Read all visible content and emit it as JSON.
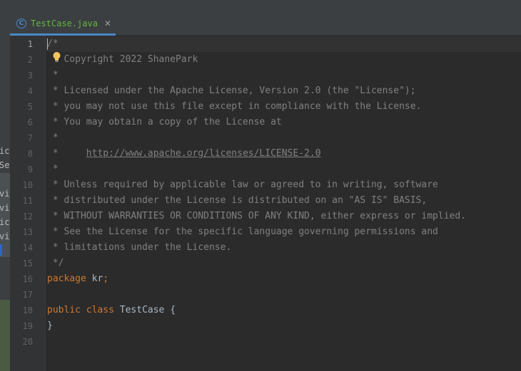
{
  "tab": {
    "icon": "class-icon",
    "icon_glyph": "C",
    "label": "TestCase.java",
    "close_glyph": "✕"
  },
  "left_panel_fragments": [
    "ic",
    "Se",
    "vi",
    "vi",
    "ic",
    "vi"
  ],
  "gutter": {
    "lines": [
      "1",
      "2",
      "3",
      "4",
      "5",
      "6",
      "7",
      "8",
      "9",
      "10",
      "11",
      "12",
      "13",
      "14",
      "15",
      "16",
      "17",
      "18",
      "19",
      "20"
    ]
  },
  "code": {
    "l1": "/*",
    "l2": " * Copyright 2022 ShanePark",
    "l3": " *",
    "l4": " * Licensed under the Apache License, Version 2.0 (the \"License\");",
    "l5": " * you may not use this file except in compliance with the License.",
    "l6": " * You may obtain a copy of the License at",
    "l7": " *",
    "l8_prefix": " *     ",
    "l8_link": "http://www.apache.org/licenses/LICENSE-2.0",
    "l9": " *",
    "l10": " * Unless required by applicable law or agreed to in writing, software",
    "l11": " * distributed under the License is distributed on an \"AS IS\" BASIS,",
    "l12": " * WITHOUT WARRANTIES OR CONDITIONS OF ANY KIND, either express or implied.",
    "l13": " * See the License for the specific language governing permissions and",
    "l14": " * limitations under the License.",
    "l15": " */",
    "l16_kw": "package",
    "l16_name": "kr",
    "l16_semi": ";",
    "l18_kw1": "public",
    "l18_kw2": "class",
    "l18_name": "TestCase",
    "l18_brace": "{",
    "l19": "}"
  },
  "colors": {
    "comment": "#808080",
    "keyword": "#cc7832",
    "identifier": "#a9b7c6",
    "tab_label": "#62b543",
    "accent": "#4a88c7"
  }
}
